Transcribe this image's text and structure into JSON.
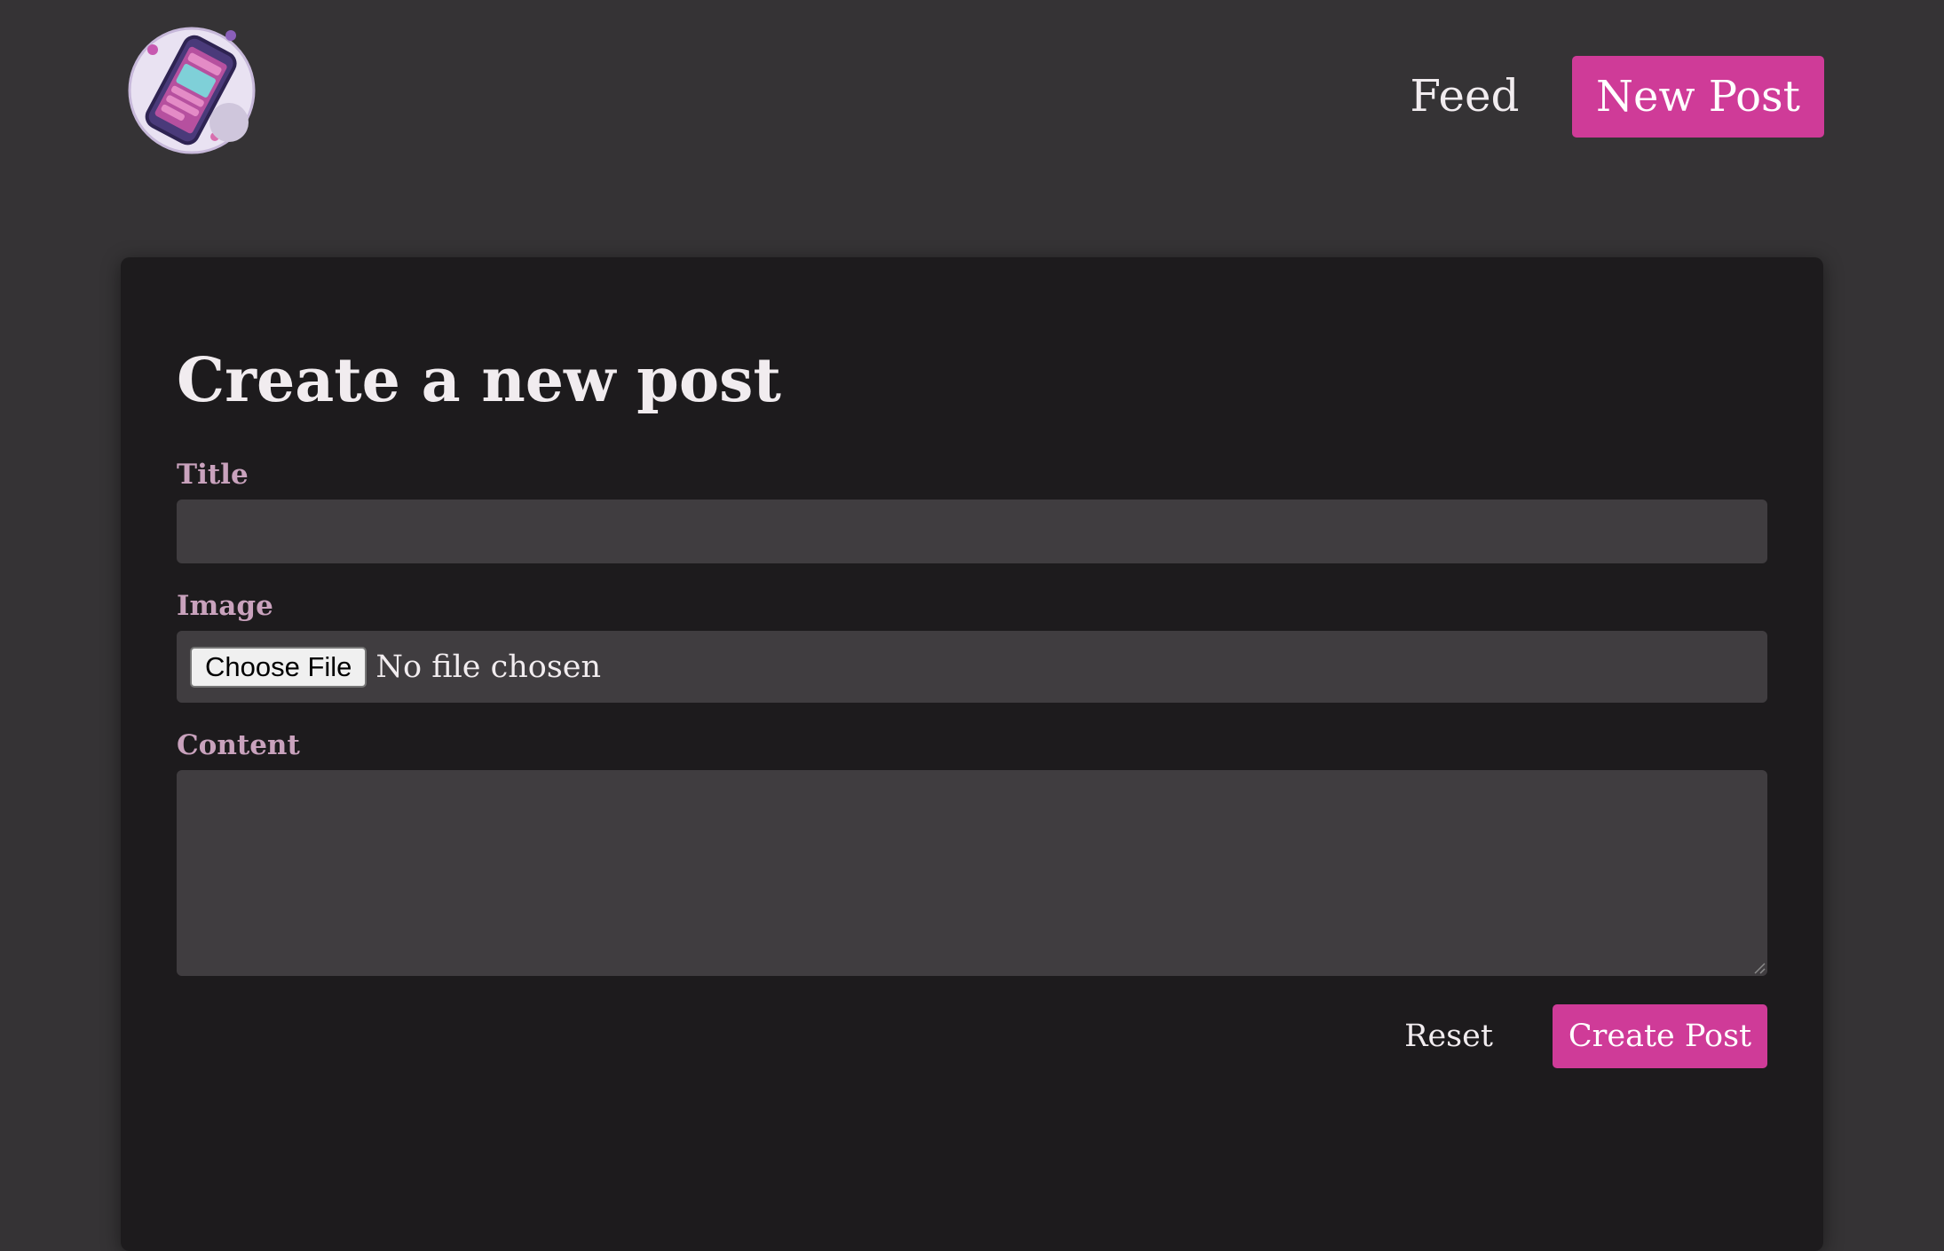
{
  "nav": {
    "feed_label": "Feed",
    "new_post_label": "New Post",
    "logo_icon": "phone-social-logo-icon"
  },
  "form": {
    "heading": "Create a new post",
    "title_label": "Title",
    "title_value": "",
    "image_label": "Image",
    "choose_file_label": "Choose File",
    "no_file_text": "No file chosen",
    "content_label": "Content",
    "content_value": "",
    "reset_label": "Reset",
    "submit_label": "Create Post"
  },
  "colors": {
    "page_background": "#353335",
    "card_background": "#1d1b1d",
    "field_background": "#403d40",
    "accent": "#cf3b98",
    "label": "#c9a2bd",
    "text": "#f1ecef"
  }
}
